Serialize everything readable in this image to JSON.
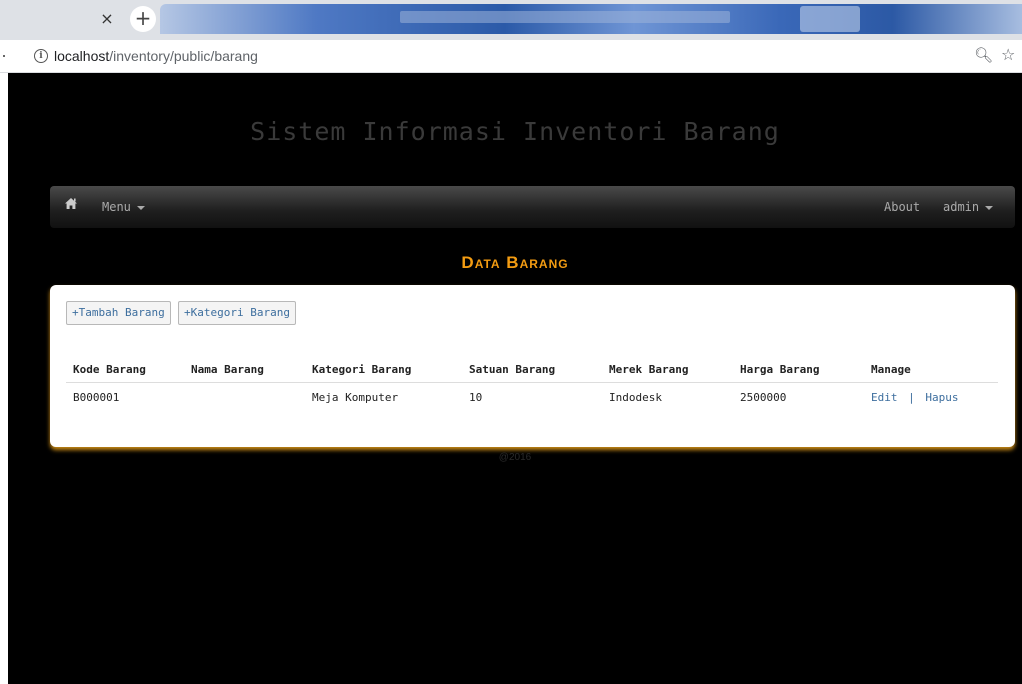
{
  "browser": {
    "close_tab": "×",
    "new_tab": "+",
    "url_host": "localhost",
    "url_path": "/inventory/public/barang"
  },
  "site": {
    "title": "Sistem Informasi Inventori Barang"
  },
  "navbar": {
    "menu_label": "Menu",
    "about_label": "About",
    "user_label": "admin"
  },
  "page": {
    "heading": "Data Barang"
  },
  "actions": {
    "add_item": "+Tambah Barang",
    "add_category": "+Kategori Barang"
  },
  "table": {
    "columns": [
      "Kode Barang",
      "Nama Barang",
      "Kategori Barang",
      "Satuan Barang",
      "Merek Barang",
      "Harga Barang",
      "Manage"
    ],
    "rows": [
      {
        "kode": "B000001",
        "nama": "",
        "kategori": "Meja Komputer",
        "satuan": "10",
        "merek": "Indodesk",
        "harga": "2500000",
        "edit": "Edit",
        "separator": "|",
        "hapus": "Hapus"
      }
    ]
  },
  "footer": {
    "text": "@2016"
  },
  "colors": {
    "accent": "#f39c12",
    "link": "#3d6e9e",
    "background": "#000000"
  },
  "icons": [
    "info-icon",
    "zoom-icon",
    "star-icon",
    "home-icon",
    "caret-down-icon"
  ]
}
